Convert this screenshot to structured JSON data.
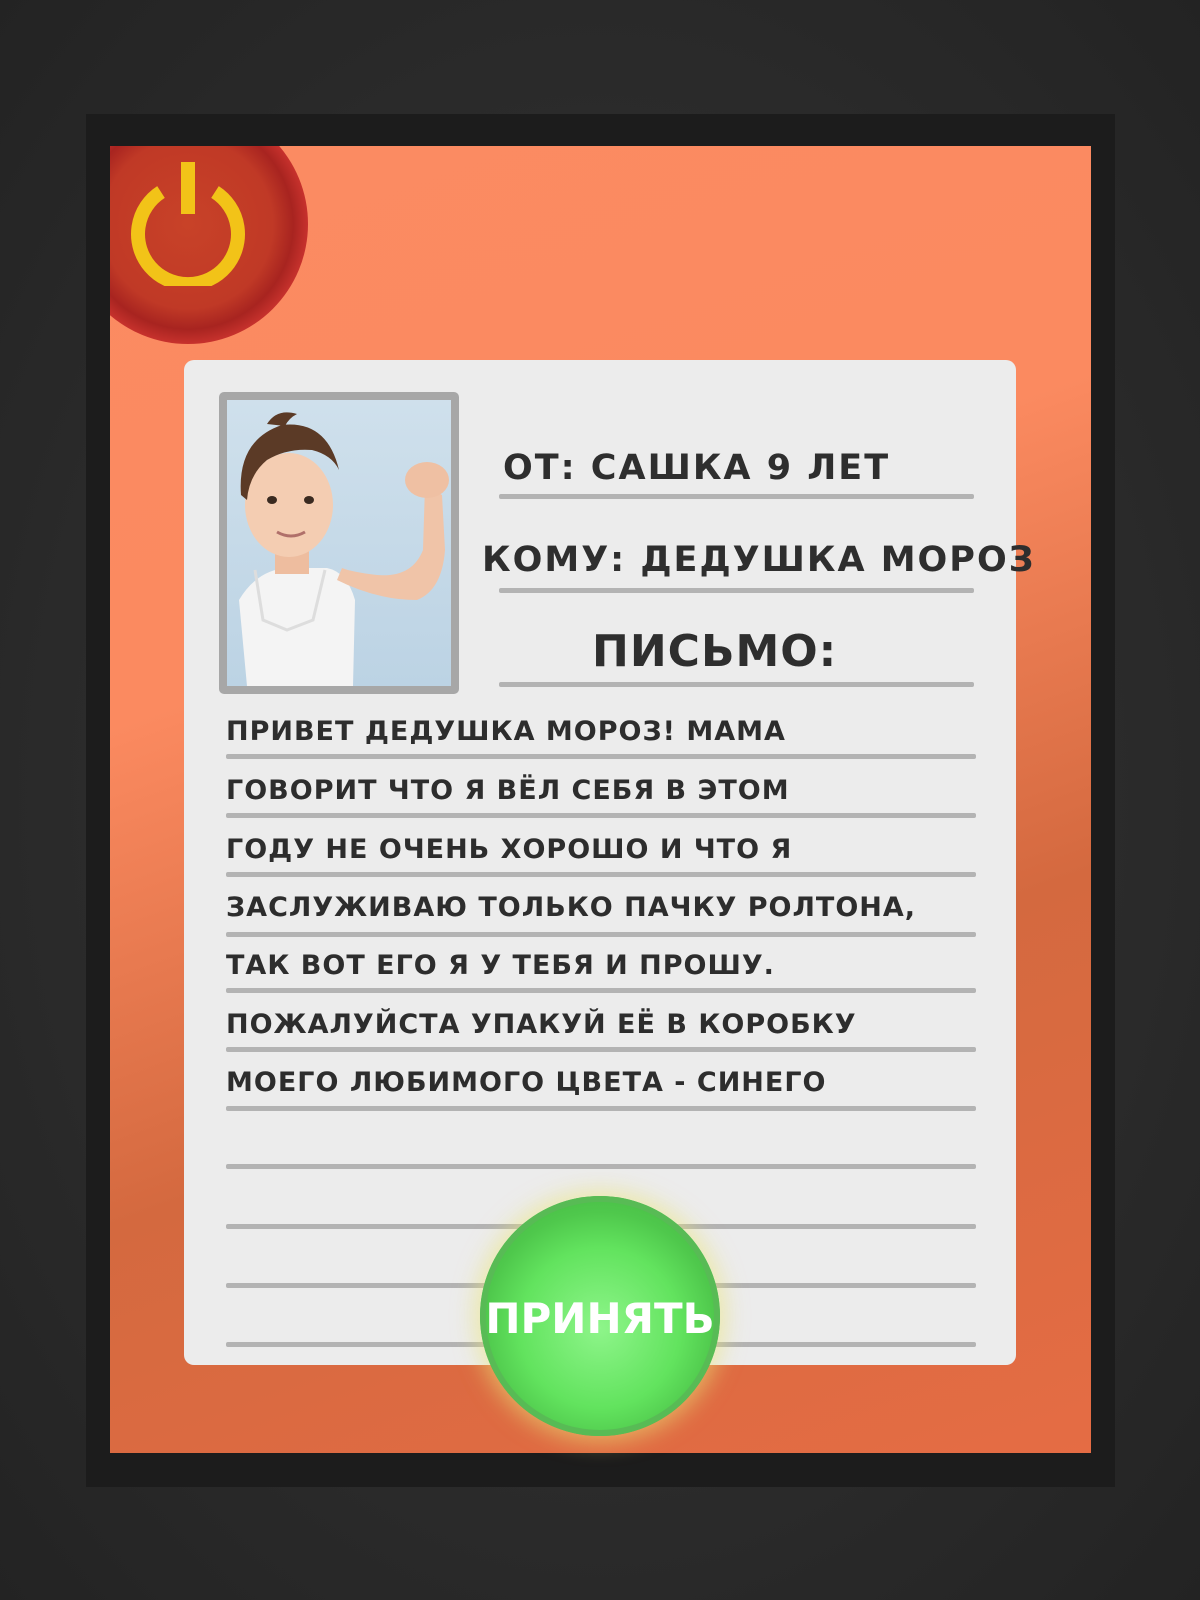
{
  "header": {
    "from_text": "ОТ: САШКА 9 ЛЕТ",
    "to_text": "КОМУ: ДЕДУШКА МОРОЗ",
    "letter_heading": "ПИСЬМО:"
  },
  "letter": {
    "lines": [
      "ПРИВЕТ ДЕДУШКА МОРОЗ! МАМА",
      "ГОВОРИТ ЧТО Я ВЁЛ СЕБЯ В ЭТОМ",
      "ГОДУ НЕ ОЧЕНЬ ХОРОШО И ЧТО Я",
      "ЗАСЛУЖИВАЮ ТОЛЬКО ПАЧКУ РОЛТОНА,",
      "ТАК ВОТ ЕГО Я У ТЕБЯ И ПРОШУ.",
      "ПОЖАЛУЙСТА УПАКУЙ ЕЁ В КОРОБКУ",
      "МОЕГО ЛЮБИМОГО ЦВЕТА - СИНЕГО"
    ]
  },
  "buttons": {
    "accept_label": "ПРИНЯТЬ",
    "power_icon": "power-icon"
  },
  "colors": {
    "background": "#fb8b62",
    "power_ring": "#f24a44",
    "power_symbol": "#f2c318",
    "accept": "#62e35e",
    "card": "#ececec"
  }
}
